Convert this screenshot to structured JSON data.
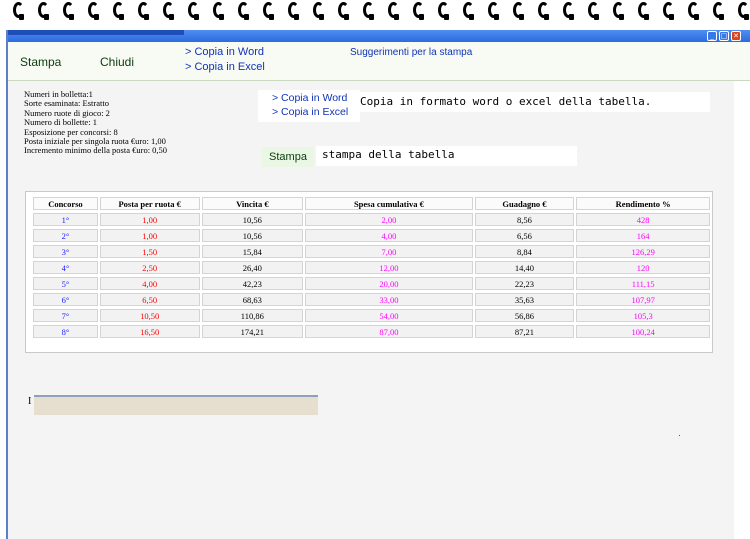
{
  "window": {
    "controls": {
      "minimize": "_",
      "maximize": "□",
      "close": "✕"
    }
  },
  "toolbar": {
    "stampa": "Stampa",
    "chiudi": "Chiudi",
    "copia_word": "> Copia in Word",
    "copia_excel": "> Copia in Excel",
    "suggerimenti": "Suggerimenti per la stampa"
  },
  "info": [
    "Numeri in bolletta:1",
    "Sorte esaminata: Estratto",
    "Numero ruote di gioco: 2",
    "Numero di bollette: 1",
    "Esposizione per concorsi: 8",
    "Posta iniziale per singola ruota €uro: 1,00",
    "Incremento minimo della posta €uro: 0,50"
  ],
  "copy_panel": {
    "word": "> Copia in Word",
    "excel": "> Copia in Excel",
    "description": "Copia in formato word o excel della tabella."
  },
  "print_panel": {
    "button": "Stampa",
    "description": "stampa della tabella"
  },
  "table": {
    "headers": [
      "Concorso",
      "Posta per ruota €",
      "Vincita €",
      "Spesa cumulativa €",
      "Guadagno €",
      "Rendimento %"
    ],
    "rows": [
      [
        "1°",
        "1,00",
        "10,56",
        "2,00",
        "8,56",
        "428"
      ],
      [
        "2°",
        "1,00",
        "10,56",
        "4,00",
        "6,56",
        "164"
      ],
      [
        "3°",
        "1,50",
        "15,84",
        "7,00",
        "8,84",
        "126,29"
      ],
      [
        "4°",
        "2,50",
        "26,40",
        "12,00",
        "14,40",
        "120"
      ],
      [
        "5°",
        "4,00",
        "42,23",
        "20,00",
        "22,23",
        "111,15"
      ],
      [
        "6°",
        "6,50",
        "68,63",
        "33,00",
        "35,63",
        "107,97"
      ],
      [
        "7°",
        "10,50",
        "110,86",
        "54,00",
        "56,86",
        "105,3"
      ],
      [
        "8°",
        "16,50",
        "174,21",
        "87,00",
        "87,21",
        "100,24"
      ]
    ]
  },
  "colors": {
    "concorso": "#1a1aff",
    "posta": "#ff0000",
    "vincita": "#000000",
    "spesa": "#ff00ff",
    "guadagno": "#000000",
    "rendimento": "#ff00ff"
  }
}
